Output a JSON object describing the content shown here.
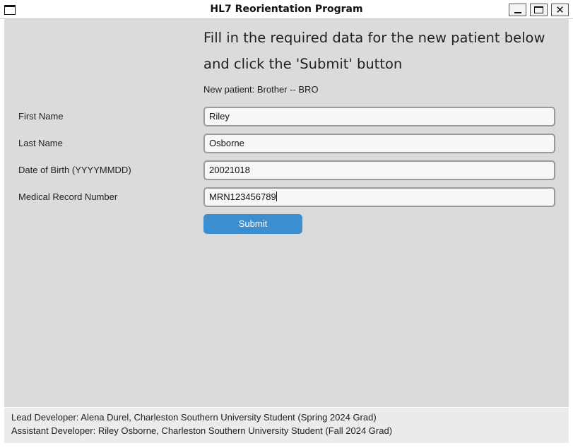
{
  "window": {
    "title": "HL7 Reorientation Program",
    "icons": [
      "app-icon",
      "minimize-icon",
      "maximize-icon",
      "close-icon"
    ]
  },
  "instructions": {
    "line1": "Fill in the required data for the new patient below",
    "line2": "and click the 'Submit' button"
  },
  "patient_info": "New patient: Brother -- BRO",
  "form": {
    "fields": [
      {
        "label": "First Name",
        "value": "Riley"
      },
      {
        "label": "Last Name",
        "value": "Osborne"
      },
      {
        "label": "Date of Birth (YYYYMMDD)",
        "value": "20021018"
      },
      {
        "label": "Medical Record Number",
        "value": "MRN123456789"
      }
    ],
    "submit_label": "Submit"
  },
  "footer": {
    "lead": "Lead Developer: Alena Durel, Charleston Southern University Student (Spring 2024 Grad)",
    "assistant": "Assistant Developer: Riley Osborne, Charleston Southern University Student (Fall 2024 Grad)"
  },
  "colors": {
    "accent": "#3b8ed0",
    "panel": "#dbdbdb",
    "footer_bg": "#ebebeb"
  }
}
